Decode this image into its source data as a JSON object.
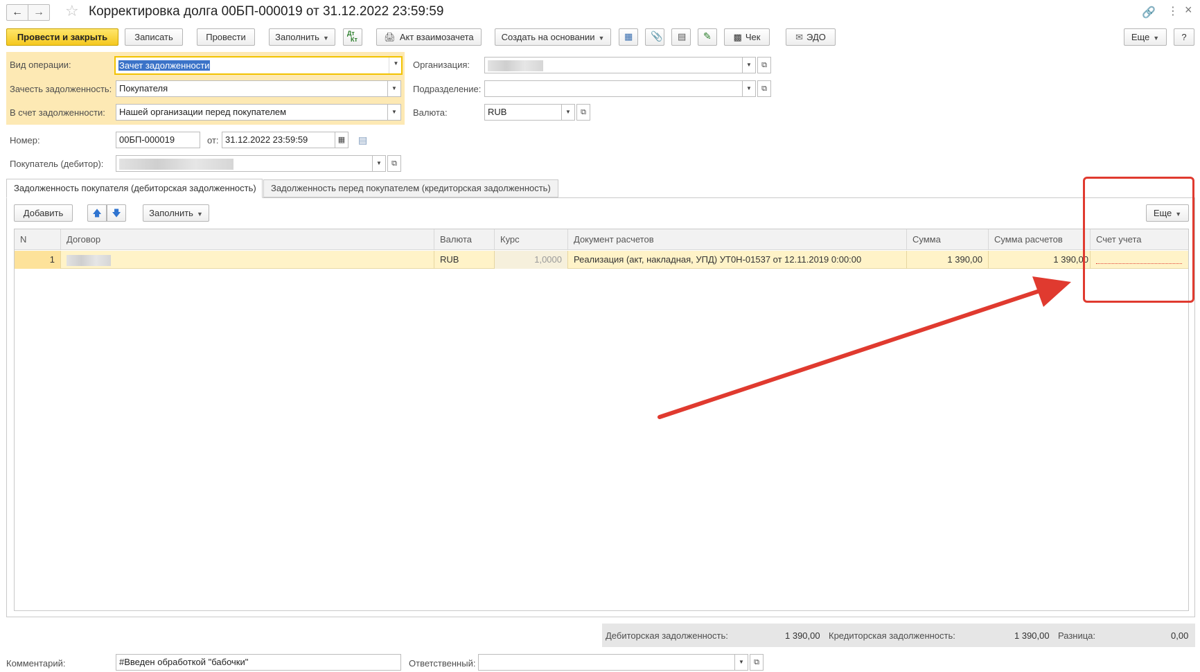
{
  "window": {
    "title": "Корректировка долга 00БП-000019 от 31.12.2022 23:59:59"
  },
  "toolbar": {
    "post_close": "Провести и закрыть",
    "save": "Записать",
    "post": "Провести",
    "fill": "Заполнить",
    "akt": "Акт взаимозачета",
    "create_based": "Создать на основании",
    "check": "Чек",
    "edo": "ЭДО",
    "more": "Еще",
    "help": "?"
  },
  "form": {
    "operation_label": "Вид операции:",
    "operation_value": "Зачет задолженности",
    "offset_label": "Зачесть задолженность:",
    "offset_value": "Покупателя",
    "account_label": "В счет задолженности:",
    "account_value": "Нашей организации перед покупателем",
    "org_label": "Организация:",
    "dept_label": "Подразделение:",
    "currency_label": "Валюта:",
    "currency_value": "RUB",
    "number_label": "Номер:",
    "number_value": "00БП-000019",
    "date_label": "от:",
    "date_value": "31.12.2022 23:59:59",
    "buyer_label": "Покупатель (дебитор):"
  },
  "tabs": [
    {
      "label": "Задолженность покупателя (дебиторская задолженность)"
    },
    {
      "label": "Задолженность перед покупателем (кредиторская задолженность)"
    }
  ],
  "table_toolbar": {
    "add": "Добавить",
    "fill": "Заполнить",
    "more": "Еще"
  },
  "table": {
    "columns": [
      "N",
      "Договор",
      "Валюта",
      "Курс",
      "Документ расчетов",
      "Сумма",
      "Сумма расчетов",
      "Счет учета"
    ],
    "rows": [
      {
        "n": "1",
        "currency": "RUB",
        "rate": "1,0000",
        "document": "Реализация (акт, накладная, УПД) УТ0Н-01537 от 12.11.2019 0:00:00",
        "sum": "1 390,00",
        "settle_sum": "1 390,00"
      }
    ]
  },
  "totals": {
    "debit_label": "Дебиторская задолженность:",
    "debit_value": "1 390,00",
    "credit_label": "Кредиторская задолженность:",
    "credit_value": "1 390,00",
    "diff_label": "Разница:",
    "diff_value": "0,00"
  },
  "footer": {
    "comment_label": "Комментарий:",
    "comment_value": "#Введен обработкой \"бабочки\"",
    "responsible_label": "Ответственный:"
  },
  "colors": {
    "primary_button": "#f5c81f",
    "highlight_panel": "#fde9b4",
    "selected_row": "#fff3c8",
    "annotation_red": "#e03a2f"
  }
}
